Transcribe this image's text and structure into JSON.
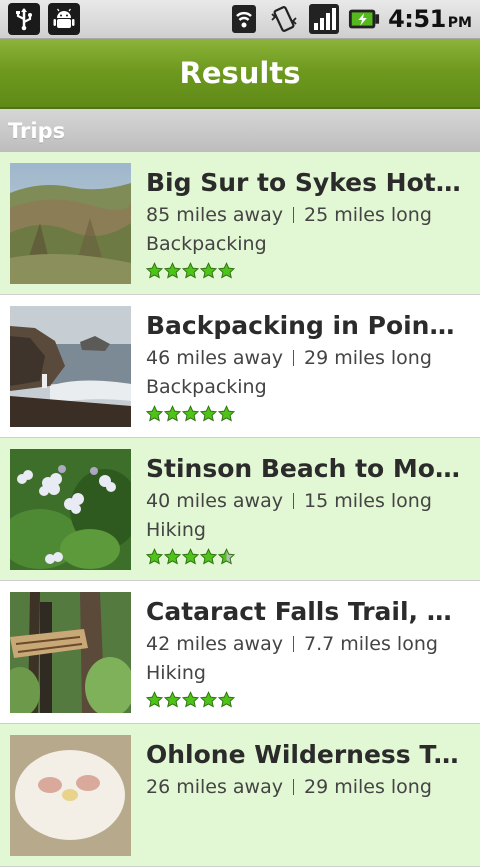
{
  "status_bar": {
    "time": "4:51",
    "ampm": "PM",
    "icons": [
      "usb-icon",
      "android-debug-icon",
      "wifi-icon",
      "vibrate-icon",
      "signal-icon",
      "battery-icon"
    ]
  },
  "header": {
    "title": "Results"
  },
  "section": {
    "label": "Trips"
  },
  "trips": [
    {
      "title": "Big Sur to Sykes Hot S...",
      "distance": "85 miles away",
      "length": "25 miles long",
      "type": "Backpacking",
      "rating": 5,
      "image": "coastal-hills-photo"
    },
    {
      "title": "Backpacking in Point ...",
      "distance": "46 miles away",
      "length": "29 miles long",
      "type": "Backpacking",
      "rating": 5,
      "image": "rocky-coast-photo"
    },
    {
      "title": "Stinson Beach to Mou...",
      "distance": "40 miles away",
      "length": "15 miles long",
      "type": "Hiking",
      "rating": 4.5,
      "image": "wildflowers-photo"
    },
    {
      "title": "Cataract Falls Trail, M...",
      "distance": "42 miles away",
      "length": "7.7 miles long",
      "type": "Hiking",
      "rating": 5,
      "image": "trail-sign-photo"
    },
    {
      "title": "Ohlone Wilderness Trail",
      "distance": "26 miles away",
      "length": "29 miles long",
      "type": "",
      "rating": 0,
      "image": "white-flower-photo"
    }
  ],
  "colors": {
    "header_green": "#6f9a1f",
    "row_alt": "#e2f7d3",
    "star_fill": "#4ec418"
  }
}
